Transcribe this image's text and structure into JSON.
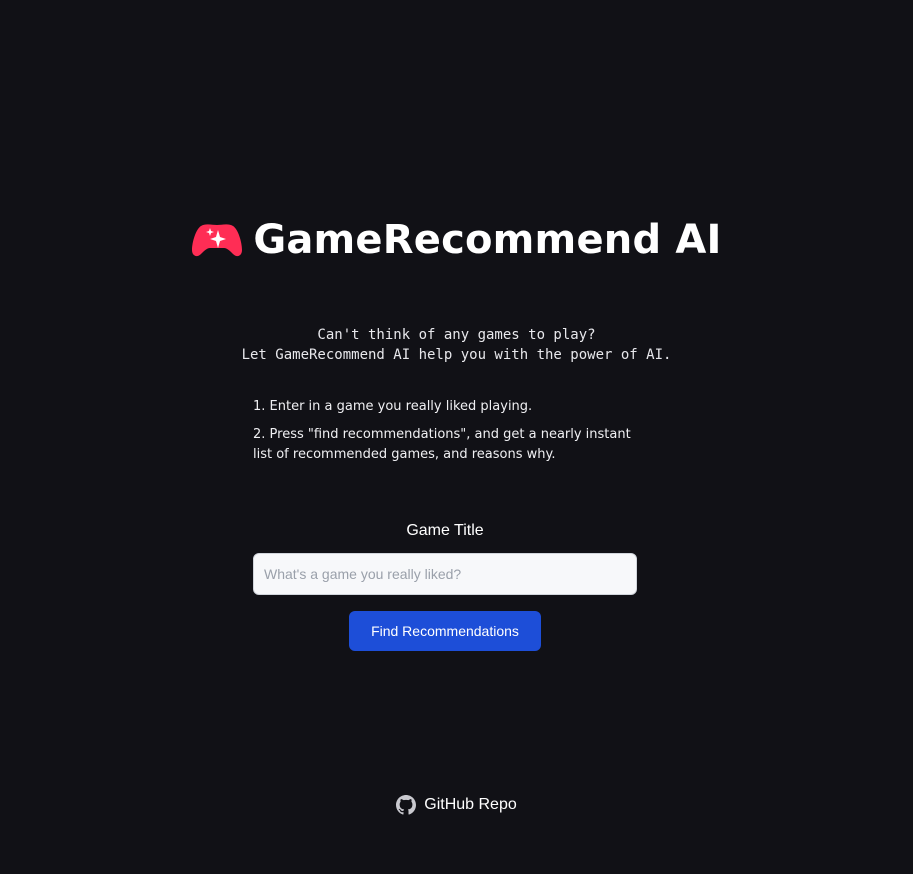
{
  "header": {
    "title": "GameRecommend AI",
    "logo_icon": "game-controller-sparkle-icon",
    "accent_color": "#ff2d55"
  },
  "tagline": {
    "line1": "Can't think of any games to play?",
    "line2": "Let GameRecommend AI help you with the power of AI."
  },
  "steps": [
    "1. Enter in a game you really liked playing.",
    "2. Press \"find recommendations\", and get a nearly instant list of recommended games, and reasons why."
  ],
  "form": {
    "label": "Game Title",
    "input_value": "",
    "input_placeholder": "What's a game you really liked?",
    "button_label": "Find Recommendations",
    "button_color": "#1d4ed8"
  },
  "footer": {
    "link_label": "GitHub Repo",
    "icon": "github-icon"
  },
  "colors": {
    "background": "#111116",
    "text": "#ffffff"
  }
}
